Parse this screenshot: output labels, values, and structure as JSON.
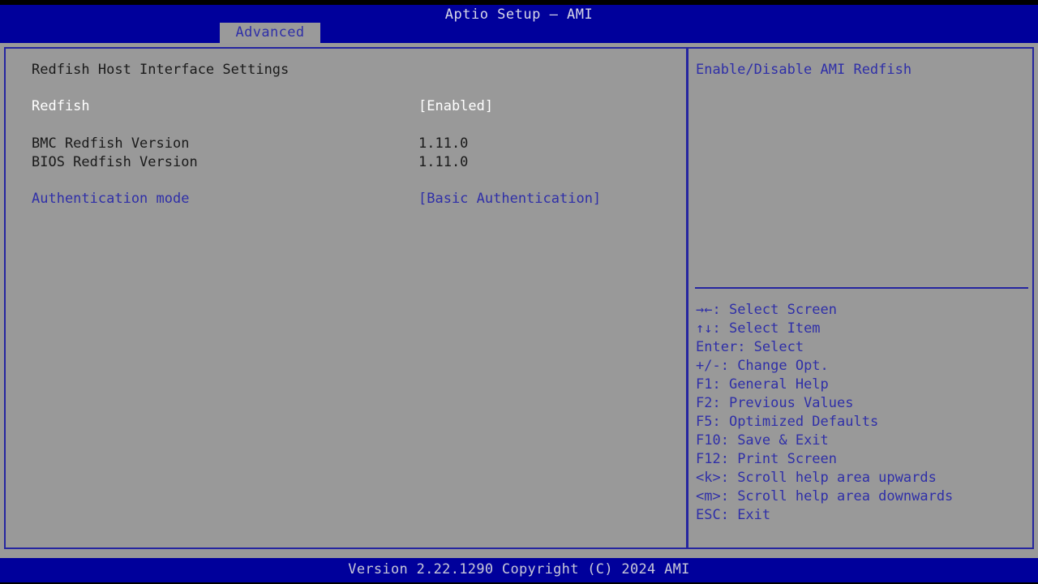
{
  "window": {
    "title": "Aptio Setup – AMI"
  },
  "tabs": [
    {
      "label": "Advanced",
      "active": true
    }
  ],
  "settings_pane": {
    "section_title": "Redfish Host Interface Settings",
    "rows": [
      {
        "label": "Redfish",
        "value": "[Enabled]",
        "style": "selected"
      },
      {
        "label": "BMC Redfish Version",
        "value": "1.11.0",
        "style": "readonly"
      },
      {
        "label": "BIOS Redfish Version",
        "value": "1.11.0",
        "style": "readonly"
      },
      {
        "label": "Authentication mode",
        "value": "[Basic Authentication]",
        "style": "option"
      }
    ]
  },
  "help_pane": {
    "description": "Enable/Disable AMI Redfish",
    "legend": [
      {
        "keys": "→←",
        "text": ": Select Screen"
      },
      {
        "keys": "↑↓",
        "text": ": Select Item"
      },
      {
        "keys": "Enter",
        "text": ": Select"
      },
      {
        "keys": "+/-",
        "text": ": Change Opt."
      },
      {
        "keys": "F1",
        "text": ": General Help"
      },
      {
        "keys": "F2",
        "text": ": Previous Values"
      },
      {
        "keys": "F5",
        "text": ": Optimized Defaults"
      },
      {
        "keys": "F10",
        "text": ": Save & Exit"
      },
      {
        "keys": "F12",
        "text": ": Print Screen"
      },
      {
        "keys": "<k>",
        "text": ": Scroll help area upwards"
      },
      {
        "keys": "<m>",
        "text": ": Scroll help area downwards"
      },
      {
        "keys": "ESC",
        "text": ": Exit"
      }
    ]
  },
  "footer": {
    "version_text": "Version 2.22.1290 Copyright (C) 2024 AMI"
  },
  "colors": {
    "header_blue": "#00009B",
    "body_gray": "#999999",
    "border_blue": "#2525A0",
    "text_blue": "#2F2FA8",
    "text_black": "#1A1A1A",
    "text_white": "#FFFFFF",
    "footer_text": "#C8C8D8"
  }
}
